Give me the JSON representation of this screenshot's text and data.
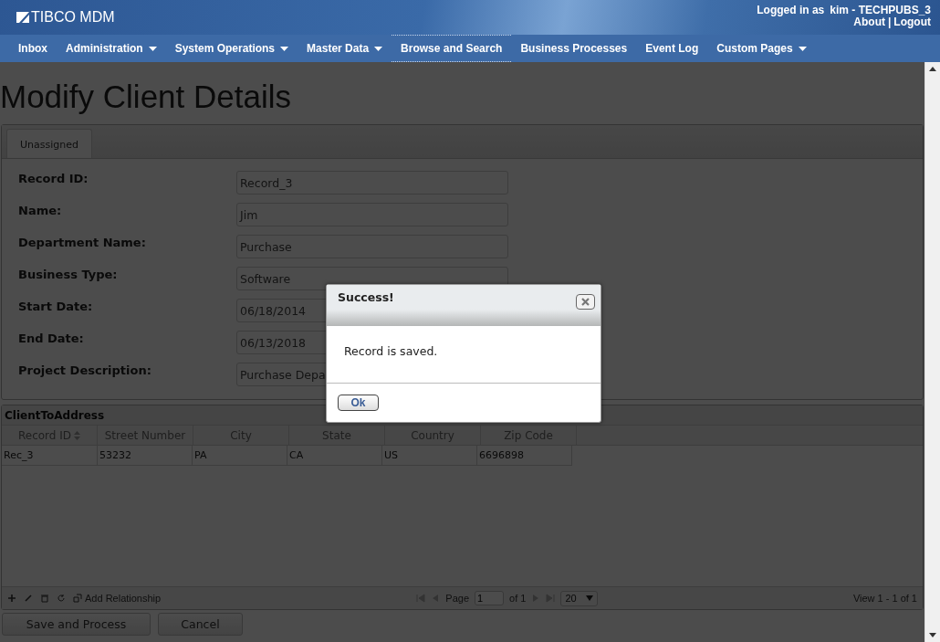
{
  "header": {
    "logo": "TIBCO MDM",
    "logged_in_label": "Logged in as",
    "user": "kim - TECHPUBS_3",
    "links": [
      "About",
      "Logout"
    ],
    "separator": "|"
  },
  "nav": [
    {
      "label": "Inbox",
      "menu": false,
      "selected": false
    },
    {
      "label": "Administration",
      "menu": true,
      "selected": false
    },
    {
      "label": "System Operations",
      "menu": true,
      "selected": false
    },
    {
      "label": "Master Data",
      "menu": true,
      "selected": false
    },
    {
      "label": "Browse and Search",
      "menu": false,
      "selected": true
    },
    {
      "label": "Business Processes",
      "menu": false,
      "selected": false
    },
    {
      "label": "Event Log",
      "menu": false,
      "selected": false
    },
    {
      "label": "Custom Pages",
      "menu": true,
      "selected": false
    }
  ],
  "page_title": "Modify Client Details",
  "tabs": [
    {
      "label": "Unassigned",
      "selected": true
    }
  ],
  "fields": [
    {
      "label": "Record ID:",
      "value": "Record_3"
    },
    {
      "label": "Name:",
      "value": "Jim"
    },
    {
      "label": "Department Name:",
      "value": "Purchase"
    },
    {
      "label": "Business Type:",
      "value": "Software"
    },
    {
      "label": "Start Date:",
      "value": "06/18/2014"
    },
    {
      "label": "End Date:",
      "value": "06/13/2018"
    },
    {
      "label": "Project Description:",
      "value": "Purchase Depa"
    }
  ],
  "grid": {
    "title": "ClientToAddress",
    "columns": [
      {
        "label": "Record ID",
        "sorted": true
      },
      {
        "label": "Street Number",
        "sorted": false
      },
      {
        "label": "City",
        "sorted": false
      },
      {
        "label": "State",
        "sorted": false
      },
      {
        "label": "Country",
        "sorted": false
      },
      {
        "label": "Zip Code",
        "sorted": false
      }
    ],
    "rows": [
      [
        "Rec_3",
        "53232",
        "PA",
        "CA",
        "US",
        "6696898"
      ]
    ],
    "toolbar": {
      "add_relationship": "Add Relationship",
      "page_label": "Page",
      "page": "1",
      "of": "of 1",
      "page_size": "20",
      "view": "View 1 - 1 of 1"
    }
  },
  "buttons": [
    "Save and Process",
    "Cancel"
  ],
  "dialog": {
    "title": "Success!",
    "message": "Record is saved.",
    "button": "Ok"
  }
}
